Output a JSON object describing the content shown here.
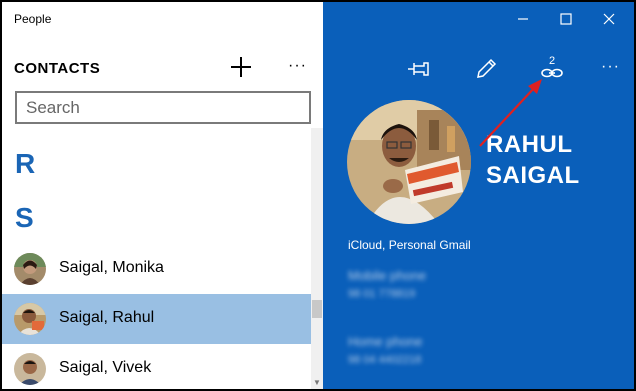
{
  "app": {
    "title": "People"
  },
  "contacts": {
    "header": "CONTACTS",
    "search_placeholder": "Search",
    "groups": [
      "R",
      "S"
    ],
    "items": [
      {
        "name": "Saigal, Monika",
        "selected": false
      },
      {
        "name": "Saigal, Rahul",
        "selected": true
      },
      {
        "name": "Saigal, Vivek",
        "selected": false
      }
    ]
  },
  "toolbar": {
    "icons": [
      "add-icon",
      "more-icon",
      "pin-icon",
      "edit-icon",
      "link-icon",
      "more-icon"
    ],
    "linked_count": "2"
  },
  "profile": {
    "first_name": "RAHUL",
    "last_name": "SAIGAL",
    "source": "iCloud, Personal Gmail",
    "fields": [
      {
        "label": "Mobile phone",
        "value": "98 01 778819"
      },
      {
        "label": "Home phone",
        "value": "98 04 4402218"
      }
    ]
  },
  "colors": {
    "accent_blue": "#0a5fba",
    "selection": "#99bfe3",
    "group_letter": "#1a65b5",
    "annotation_arrow": "#e02020"
  }
}
